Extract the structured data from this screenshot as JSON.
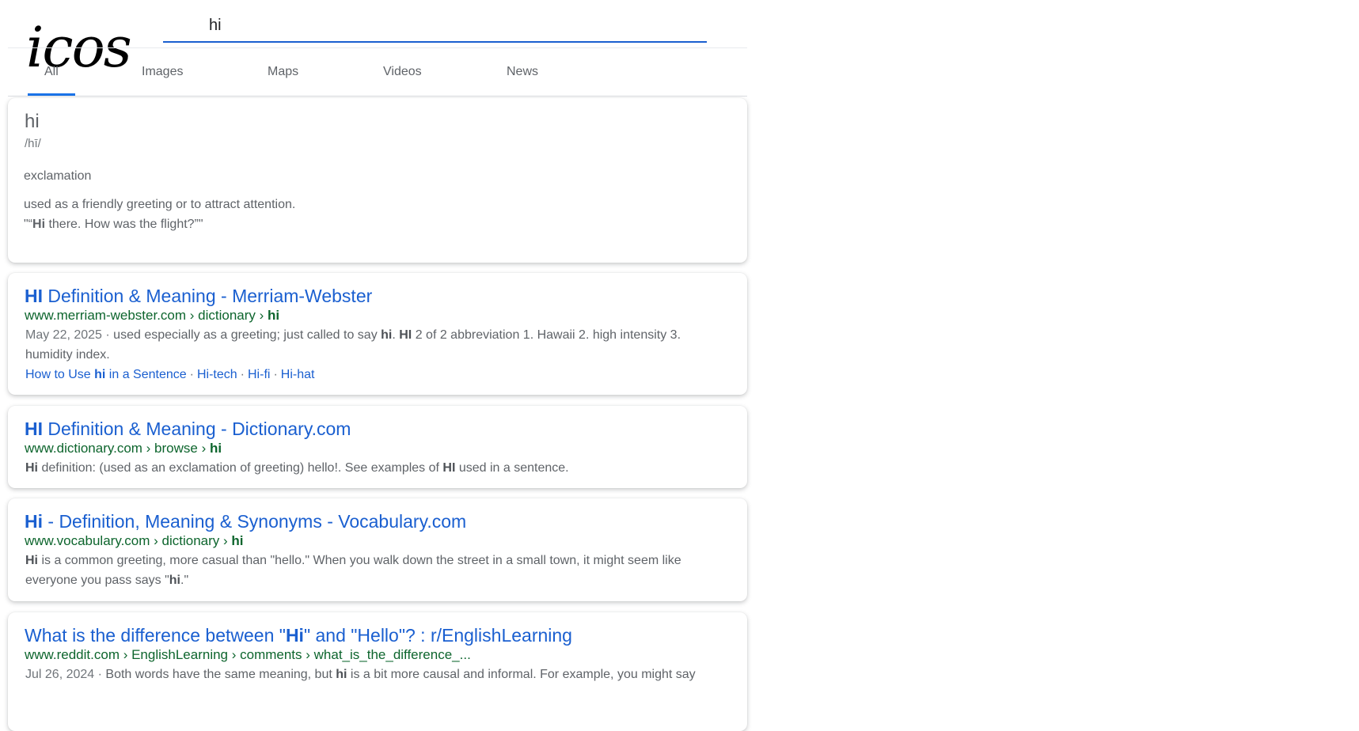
{
  "logo": {
    "text": "icos"
  },
  "search": {
    "value": "hi"
  },
  "tabs": [
    {
      "label": "All",
      "active": true
    },
    {
      "label": "Images"
    },
    {
      "label": "Maps"
    },
    {
      "label": "Videos"
    },
    {
      "label": "News"
    }
  ],
  "dictionary": {
    "word": "hi",
    "phonetic": "/hī/",
    "part_of_speech": "exclamation",
    "definition": "used as a friendly greeting or to attract attention.",
    "example_prefix": "\"“",
    "example_bold": "Hi",
    "example_rest": " there. How was the flight?”\""
  },
  "results": [
    {
      "title_bold": "HI",
      "title_rest": " Definition & Meaning - Merriam-Webster",
      "url_text": "www.merriam-webster.com › dictionary › ",
      "url_bold": "hi",
      "date": "May 22, 2025",
      "snippet_1": "used especially as a greeting; just called to say ",
      "snippet_b1": "hi",
      "snippet_2": ". ",
      "snippet_b2": "HI",
      "snippet_3": " 2 of 2 abbreviation 1. Hawaii 2. high intensity 3. humidity index.",
      "sitelinks": {
        "l1_pre": "How to Use ",
        "l1_bold": "hi",
        "l1_post": " in a Sentence",
        "l2": "Hi-tech",
        "l3": "Hi-fi",
        "l4": "Hi-hat",
        "sep": "·"
      }
    },
    {
      "title_bold": "HI",
      "title_rest": " Definition & Meaning - Dictionary.com",
      "url_text": "www.dictionary.com › browse › ",
      "url_bold": "hi",
      "snippet_b1": "Hi",
      "snippet_1": " definition: (used as an exclamation of greeting) hello!. See examples of ",
      "snippet_b2": "HI",
      "snippet_2": " used in a sentence."
    },
    {
      "title_bold": "Hi",
      "title_rest": " - Definition, Meaning & Synonyms - Vocabulary.com",
      "url_text": "www.vocabulary.com › dictionary › ",
      "url_bold": "hi",
      "snippet_b1": "Hi",
      "snippet_1": " is a common greeting, more casual than \"hello.\" When you walk down the street in a small town, it might seem like everyone you pass says \"",
      "snippet_b2": "hi",
      "snippet_2": ".\""
    },
    {
      "title_pre": "What is the difference between \"",
      "title_bold": "Hi",
      "title_rest": "\" and \"Hello\"? : r/EnglishLearning",
      "url_text": "www.reddit.com › EnglishLearning › comments › what_is_the_difference_...",
      "date": "Jul 26, 2024",
      "snippet_1": "Both words have the same meaning, but ",
      "snippet_b1": "hi",
      "snippet_2": " is a bit more causal and informal. For example, you might say"
    }
  ],
  "date_sep": " · "
}
